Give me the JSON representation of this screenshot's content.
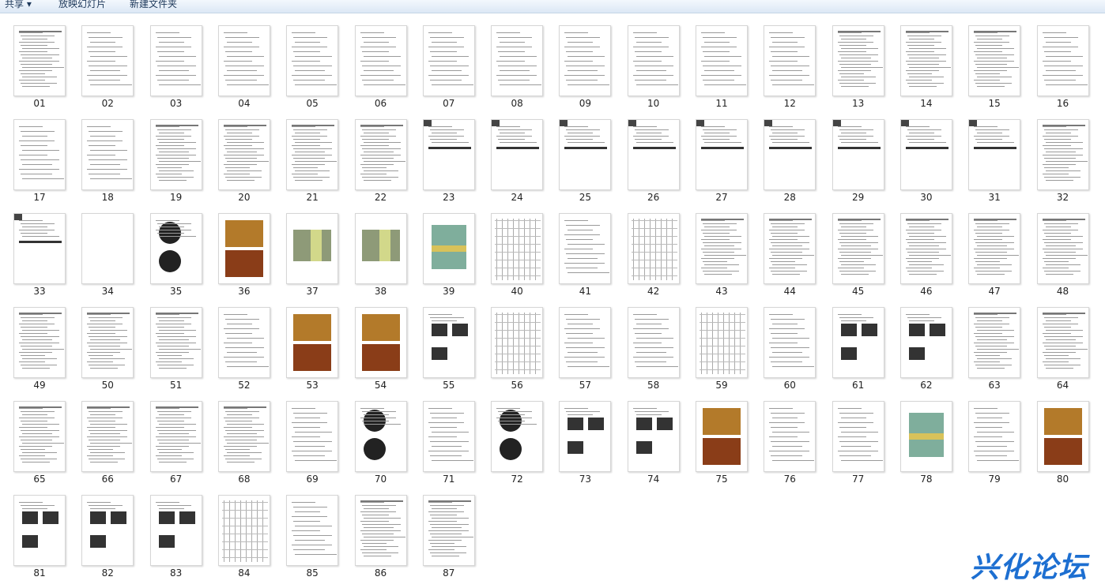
{
  "toolbar": {
    "share": "共享 ▾",
    "slideshow": "放映幻灯片",
    "new_folder": "新建文件夹"
  },
  "watermark": "兴化论坛",
  "thumbnails": [
    {
      "label": "01",
      "type": "form"
    },
    {
      "label": "02",
      "type": "text"
    },
    {
      "label": "03",
      "type": "text"
    },
    {
      "label": "04",
      "type": "text"
    },
    {
      "label": "05",
      "type": "text"
    },
    {
      "label": "06",
      "type": "text"
    },
    {
      "label": "07",
      "type": "text"
    },
    {
      "label": "08",
      "type": "text"
    },
    {
      "label": "09",
      "type": "text"
    },
    {
      "label": "10",
      "type": "text"
    },
    {
      "label": "11",
      "type": "text"
    },
    {
      "label": "12",
      "type": "text"
    },
    {
      "label": "13",
      "type": "form"
    },
    {
      "label": "14",
      "type": "form"
    },
    {
      "label": "15",
      "type": "form"
    },
    {
      "label": "16",
      "type": "text"
    },
    {
      "label": "17",
      "type": "text"
    },
    {
      "label": "18",
      "type": "text"
    },
    {
      "label": "19",
      "type": "form"
    },
    {
      "label": "20",
      "type": "form"
    },
    {
      "label": "21",
      "type": "form"
    },
    {
      "label": "22",
      "type": "form"
    },
    {
      "label": "23",
      "type": "lab"
    },
    {
      "label": "24",
      "type": "lab"
    },
    {
      "label": "25",
      "type": "lab"
    },
    {
      "label": "26",
      "type": "lab"
    },
    {
      "label": "27",
      "type": "lab"
    },
    {
      "label": "28",
      "type": "lab"
    },
    {
      "label": "29",
      "type": "lab"
    },
    {
      "label": "30",
      "type": "lab"
    },
    {
      "label": "31",
      "type": "lab"
    },
    {
      "label": "32",
      "type": "form"
    },
    {
      "label": "33",
      "type": "lab"
    },
    {
      "label": "34",
      "type": "blank"
    },
    {
      "label": "35",
      "type": "dark"
    },
    {
      "label": "36",
      "type": "fundus"
    },
    {
      "label": "37",
      "type": "photo"
    },
    {
      "label": "38",
      "type": "photo"
    },
    {
      "label": "39",
      "type": "color"
    },
    {
      "label": "40",
      "type": "chart"
    },
    {
      "label": "41",
      "type": "text"
    },
    {
      "label": "42",
      "type": "chart"
    },
    {
      "label": "43",
      "type": "form"
    },
    {
      "label": "44",
      "type": "form"
    },
    {
      "label": "45",
      "type": "form"
    },
    {
      "label": "46",
      "type": "form"
    },
    {
      "label": "47",
      "type": "form"
    },
    {
      "label": "48",
      "type": "form"
    },
    {
      "label": "49",
      "type": "form"
    },
    {
      "label": "50",
      "type": "form"
    },
    {
      "label": "51",
      "type": "form"
    },
    {
      "label": "52",
      "type": "text"
    },
    {
      "label": "53",
      "type": "fundus"
    },
    {
      "label": "54",
      "type": "fundus"
    },
    {
      "label": "55",
      "type": "scan"
    },
    {
      "label": "56",
      "type": "chart"
    },
    {
      "label": "57",
      "type": "text"
    },
    {
      "label": "58",
      "type": "text"
    },
    {
      "label": "59",
      "type": "chart"
    },
    {
      "label": "60",
      "type": "text"
    },
    {
      "label": "61",
      "type": "scan"
    },
    {
      "label": "62",
      "type": "scan"
    },
    {
      "label": "63",
      "type": "form"
    },
    {
      "label": "64",
      "type": "form"
    },
    {
      "label": "65",
      "type": "form"
    },
    {
      "label": "66",
      "type": "form"
    },
    {
      "label": "67",
      "type": "form"
    },
    {
      "label": "68",
      "type": "form"
    },
    {
      "label": "69",
      "type": "text"
    },
    {
      "label": "70",
      "type": "dark"
    },
    {
      "label": "71",
      "type": "text"
    },
    {
      "label": "72",
      "type": "dark"
    },
    {
      "label": "73",
      "type": "scan"
    },
    {
      "label": "74",
      "type": "scan"
    },
    {
      "label": "75",
      "type": "fundus"
    },
    {
      "label": "76",
      "type": "text"
    },
    {
      "label": "77",
      "type": "text"
    },
    {
      "label": "78",
      "type": "color"
    },
    {
      "label": "79",
      "type": "text"
    },
    {
      "label": "80",
      "type": "fundus"
    },
    {
      "label": "81",
      "type": "scan"
    },
    {
      "label": "82",
      "type": "scan"
    },
    {
      "label": "83",
      "type": "scan"
    },
    {
      "label": "84",
      "type": "chart"
    },
    {
      "label": "85",
      "type": "text"
    },
    {
      "label": "86",
      "type": "form"
    },
    {
      "label": "87",
      "type": "form"
    }
  ]
}
